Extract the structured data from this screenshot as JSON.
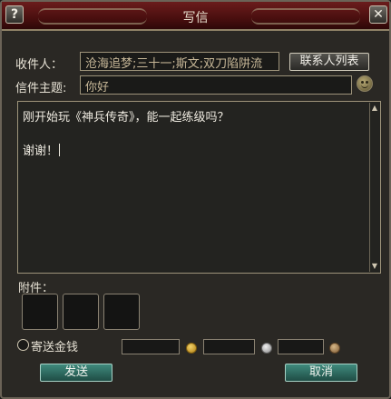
{
  "window": {
    "title": "写信"
  },
  "titlebar": {
    "help_glyph": "?",
    "close_glyph": "✕"
  },
  "recipient": {
    "label": "收件人：",
    "value": "沧海追梦;三十一;斯文;双刀陷阱流",
    "contacts_button": "联系人列表"
  },
  "subject": {
    "label": "信件主题:",
    "value": "你好"
  },
  "message": {
    "line1": "刚开始玩《神兵传奇》，能一起练级吗？",
    "line2": "谢谢！"
  },
  "attachments": {
    "label": "附件："
  },
  "money": {
    "label": "寄送金钱"
  },
  "footer": {
    "send_button": "发送",
    "cancel_button": "取消"
  },
  "colors": {
    "title_bar": "#4a0f0f",
    "accent_green": "#2f6b60",
    "gold_coin": "#d9a520",
    "silver_coin": "#bfbfbf",
    "copper_coin": "#b08a5a"
  }
}
